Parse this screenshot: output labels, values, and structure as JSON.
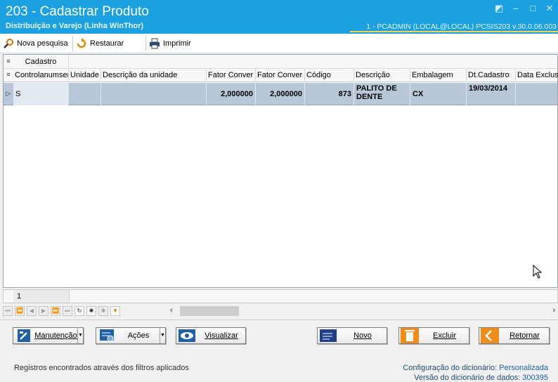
{
  "window": {
    "title": "203 - Cadastrar  Produto",
    "subtitle": "Distribuição e Varejo (Linha WinThor)",
    "userinfo": "1 - PCADMIN (LOCAL@LOCAL)   PCSIS203  v.30.0.06.003",
    "colors": {
      "titlebar": "#1ba1e2",
      "accent_line": "#ffd24a"
    }
  },
  "toolbar": {
    "nova_pesquisa": "Nova pesquisa",
    "restaurar": "Restaurar",
    "imprimir": "Imprimir"
  },
  "grid": {
    "band_label": "Cadastro",
    "columns": [
      "Controlanumser",
      "Unidade",
      "Descrição da unidade",
      "Fator Conver",
      "Fator Conver",
      "Código",
      "Descrição",
      "Embalagem",
      "Dt.Cadastro",
      "Data Exclusã"
    ],
    "row": {
      "controlanumser": "S",
      "unidade": "",
      "descricao_unidade": "",
      "fator1": "2,000000",
      "fator2": "2,000000",
      "codigo": "873",
      "descricao": "PALITO DE DENTE",
      "embalagem": "CX",
      "dt_cadastro": "19/03/2014",
      "data_exclusao": ""
    },
    "record_count": "1"
  },
  "actions": {
    "manutencao": "Manutenção",
    "acoes": "Ações",
    "visualizar": "Visualizar",
    "novo": "Novo",
    "excluir": "Excluir",
    "retornar": "Retornar"
  },
  "status": {
    "filter_text": "Registros encontrados através dos filtros aplicados",
    "config_label": "Configuração do dicionário:",
    "config_value": "Personalizada",
    "version_label": "Versão do dicionário de dados:",
    "version_value": "300395"
  }
}
